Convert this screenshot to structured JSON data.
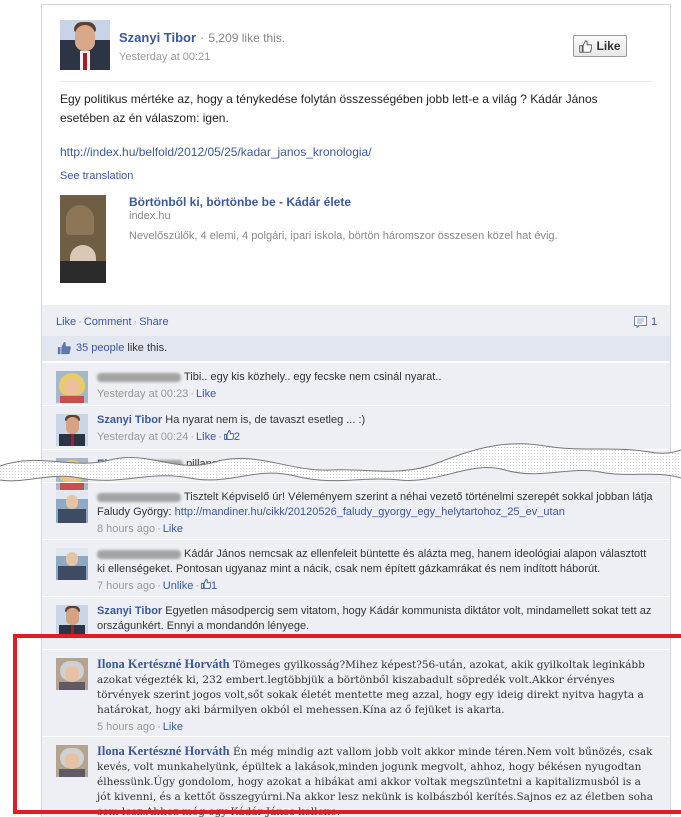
{
  "post": {
    "author": "Szanyi Tibor",
    "page_likes": "5,209 like this.",
    "timestamp": "Yesterday at 00:21",
    "like_button": "Like",
    "text": "Egy politikus mértéke az, hogy a ténykedése folytán összességében jobb lett-e a világ ? Kádár János esetében az én válaszom: igen.",
    "link": "http://index.hu/belfold/2012/05/25/kadar_janos_kronologia/",
    "see_translation": "See translation",
    "share": {
      "title": "Börtönből ki, börtönbe be - Kádár élete",
      "domain": "index.hu",
      "description": "Nevelőszülők, 4 elemi, 4 polgári, ipari iskola, börtön háromszor összesen közel hat évig."
    }
  },
  "actions": {
    "like": "Like",
    "comment": "Comment",
    "share": "Share",
    "comment_count": "1"
  },
  "likes": {
    "people": "35 people",
    "suffix": "like this."
  },
  "comments": [
    {
      "author": "",
      "text": "Tibi.. egy kis közhely.. egy fecske nem csinál nyarat..",
      "time": "Yesterday at 00:23",
      "like": "Like",
      "likes": ""
    },
    {
      "author": "Szanyi Tibor",
      "text": "Ha nyarat nem is, de tavaszt esetleg ... :)",
      "time": "Yesterday at 00:24",
      "like": "Like",
      "likes": "2"
    },
    {
      "author": "Eh",
      "text": "pillanata? :o)",
      "time": "",
      "like": "",
      "likes": ""
    },
    {
      "author": "",
      "text": "Tisztelt Képviselő úr! Véleményem szerint a néhai vezető történelmi szerepét sokkal jobban látja Faludy György: ",
      "link": "http://mandiner.hu/cikk/20120526_faludy_gyorgy_egy_helytartohoz_25_ev_utan",
      "time": "8 hours ago",
      "like": "Like",
      "likes": ""
    },
    {
      "author": "",
      "text": "Kádár János nemcsak az ellenfeleit büntette és alázta meg, hanem ideológiai alapon választott ki ellenségeket. Pontosan ugyanaz mint a nácik, csak nem épített gázkamrákat és nem indított háborút.",
      "time": "7 hours ago",
      "like": "Unlike",
      "likes": "1"
    },
    {
      "author": "Szanyi Tibor",
      "text": "Egyetlen másodpercig sem vitatom, hogy Kádár kommunista diktátor volt, mindamellett sokat tett az országunkért. Ennyi a mondandón lényege.",
      "time": "",
      "like": "",
      "likes": ""
    },
    {
      "author": "Ilona Kertészné Horváth",
      "text": "Tömeges gyilkosság?Mihez képest?56-után, azokat, akik gyilkoltak leginkább azokat végezték ki, 232 embert.legtöbbjük a börtönből kiszabadult söpredék volt.Akkor érvényes törvények szerint jogos volt,sőt sokak életét mentette meg azzal, hogy egy ideig direkt nyitva hagyta a határokat, hogy aki bármilyen okból el mehessen.Kína az ő fejüket is akarta.",
      "time": "5 hours ago",
      "like": "Like",
      "likes": ""
    },
    {
      "author": "Ilona Kertészné Horváth",
      "text": "Én még mindig azt vallom jobb volt akkor minde téren.Nem volt bűnözés, csak kevés, volt munkahelyünk, épültek a lakások,minden jogunk megvolt, ahhoz, hogy békésen nyugodtan élhessünk.Úgy gondolom, hogy azokat a hibákat ami akkor voltak megszüntetni a kapitalizmusból is a jót kivenni, és a kettőt összegyúrni.Na akkor lesz nekünk is kolbászból kerítés.Sajnos ez az életben soha sem lesz.Ahhoz még egy Kádár János kellene.",
      "time": "",
      "like": "",
      "likes": ""
    }
  ],
  "colors": {
    "link": "#3b5998",
    "highlight": "#e11c24",
    "ufi_bg": "#edeff4"
  }
}
